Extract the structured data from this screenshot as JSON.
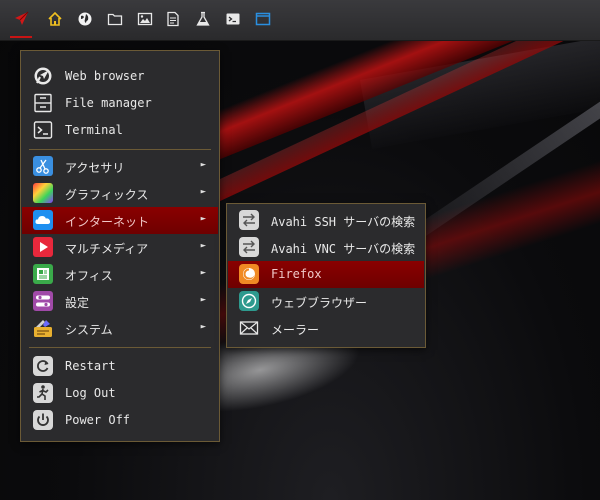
{
  "colors": {
    "accent": "#c81414",
    "highlight": "#800000",
    "border": "#6b5a36",
    "menu_bg": "#2b2b2d"
  },
  "panel": {
    "buttons": [
      {
        "icon": "app-menu-rocket-icon"
      },
      {
        "icon": "home-icon"
      },
      {
        "icon": "globe-icon"
      },
      {
        "icon": "folder-icon"
      },
      {
        "icon": "image-icon"
      },
      {
        "icon": "document-icon"
      },
      {
        "icon": "flask-icon"
      },
      {
        "icon": "terminal-icon"
      },
      {
        "icon": "window-icon"
      }
    ]
  },
  "main_menu": {
    "favorites": [
      {
        "label": "Web browser",
        "icon": "web-browser-icon"
      },
      {
        "label": "File manager",
        "icon": "file-manager-icon"
      },
      {
        "label": "Terminal",
        "icon": "terminal-icon"
      }
    ],
    "categories": [
      {
        "label": "アクセサリ",
        "icon": "accessories-icon",
        "has_submenu": true
      },
      {
        "label": "グラフィックス",
        "icon": "graphics-icon",
        "has_submenu": true
      },
      {
        "label": "インターネット",
        "icon": "internet-icon",
        "has_submenu": true,
        "selected": true
      },
      {
        "label": "マルチメディア",
        "icon": "multimedia-icon",
        "has_submenu": true
      },
      {
        "label": "オフィス",
        "icon": "office-icon",
        "has_submenu": true
      },
      {
        "label": "設定",
        "icon": "settings-icon",
        "has_submenu": true
      },
      {
        "label": "システム",
        "icon": "system-icon",
        "has_submenu": true
      }
    ],
    "session": [
      {
        "label": "Restart",
        "icon": "restart-icon"
      },
      {
        "label": "Log Out",
        "icon": "logout-icon"
      },
      {
        "label": "Power Off",
        "icon": "power-off-icon"
      }
    ],
    "submenu_arrow": "►"
  },
  "internet_submenu": {
    "items": [
      {
        "label": "Avahi SSH サーバの検索",
        "icon": "avahi-ssh-icon"
      },
      {
        "label": "Avahi VNC サーバの検索",
        "icon": "avahi-vnc-icon"
      },
      {
        "label": "Firefox",
        "icon": "firefox-icon",
        "selected": true
      },
      {
        "label": "ウェブブラウザー",
        "icon": "web-browser-safari-icon"
      },
      {
        "label": "メーラー",
        "icon": "mailer-icon"
      }
    ]
  }
}
